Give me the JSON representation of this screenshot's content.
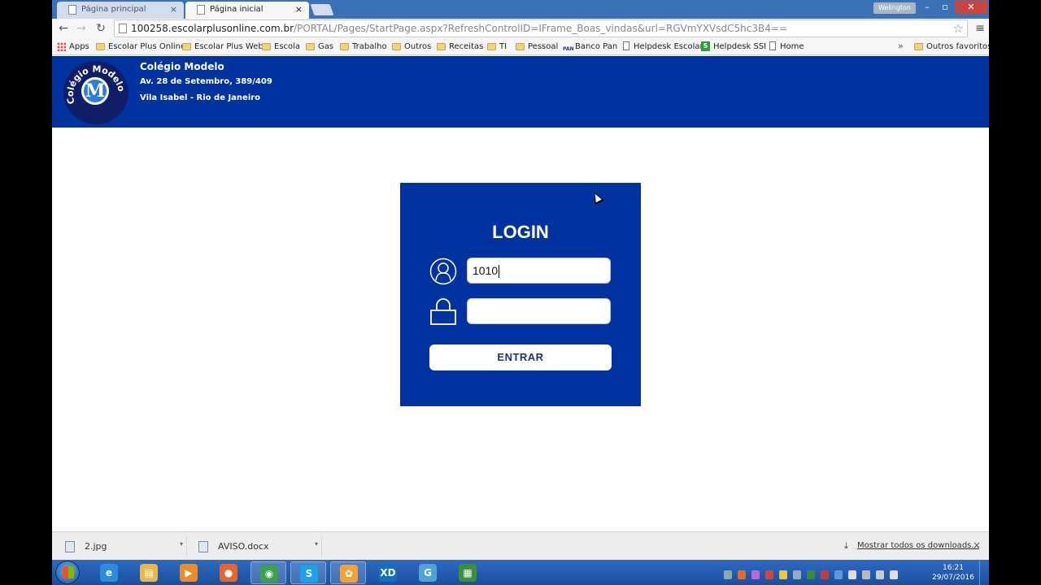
{
  "browser": {
    "tabs": [
      {
        "label": "Página principal",
        "close": "×"
      },
      {
        "label": "Página inicial",
        "close": "×"
      }
    ],
    "window_user": "Welington",
    "window_controls": {
      "min": "–",
      "max": "▫",
      "close": "✕"
    },
    "nav": {
      "back": "←",
      "forward": "→",
      "reload": "↻"
    },
    "url_host": "100258.escolarplusonline.com.br",
    "url_path": "/PORTAL/Pages/StartPage.aspx?RefreshControlID=IFrame_Boas_vindas&url=RGVmYXVsdC5hc3B4==",
    "star": "☆",
    "menu": "≡",
    "bookmarks": [
      {
        "label": "Apps",
        "icon": "apps-icon"
      },
      {
        "label": "Escolar Plus Online",
        "icon": "folder-icon"
      },
      {
        "label": "Escolar Plus Web",
        "icon": "folder-icon"
      },
      {
        "label": "Escola",
        "icon": "folder-icon"
      },
      {
        "label": "Gas",
        "icon": "folder-icon"
      },
      {
        "label": "Trabalho",
        "icon": "folder-icon"
      },
      {
        "label": "Outros",
        "icon": "folder-icon"
      },
      {
        "label": "Receitas",
        "icon": "folder-icon"
      },
      {
        "label": "TI",
        "icon": "folder-icon"
      },
      {
        "label": "Pessoal",
        "icon": "folder-icon"
      },
      {
        "label": "Banco Pan",
        "icon": "pan-icon"
      },
      {
        "label": "Helpdesk Escolar",
        "icon": "page-icon"
      },
      {
        "label": "Helpdesk SSI",
        "icon": "ssi-icon"
      },
      {
        "label": "Home",
        "icon": "page-icon"
      }
    ],
    "bookmarks_more": "»",
    "other_bookmarks": "Outros favoritos"
  },
  "site": {
    "logo_text": "Colégio Modelo",
    "logo_letter": "M",
    "name": "Colégio Modelo",
    "address_line1": "Av. 28 de Setembro, 389/409",
    "address_line2": "Vila Isabel - Rio de Janeiro"
  },
  "login": {
    "title": "LOGIN",
    "username_value": "1010",
    "password_value": "",
    "submit_label": "ENTRAR"
  },
  "downloads": {
    "items": [
      {
        "name": "2.jpg"
      },
      {
        "name": "AVISO.docx"
      }
    ],
    "show_all": "Mostrar todos os downloads...",
    "close": "×"
  },
  "taskbar": {
    "apps": [
      {
        "name": "internet-explorer",
        "glyph": "e",
        "color": "#2a8de0"
      },
      {
        "name": "file-explorer",
        "glyph": "▤",
        "color": "#e8b84a"
      },
      {
        "name": "media-player",
        "glyph": "▶",
        "color": "#f08a24"
      },
      {
        "name": "firefox",
        "glyph": "●",
        "color": "#e8662a"
      },
      {
        "name": "chrome",
        "glyph": "◉",
        "color": "#3aa04a"
      },
      {
        "name": "skype",
        "glyph": "S",
        "color": "#1aa3e8"
      },
      {
        "name": "flower-app",
        "glyph": "✿",
        "color": "#f2a23a"
      },
      {
        "name": "intel-xdk",
        "glyph": "XD",
        "color": "#1170c4"
      },
      {
        "name": "globe-app",
        "glyph": "G",
        "color": "#4fa3d8"
      },
      {
        "name": "map-app",
        "glyph": "▦",
        "color": "#3c8f3c"
      }
    ],
    "clock_time": "16:21",
    "clock_date": "29/07/2016"
  }
}
